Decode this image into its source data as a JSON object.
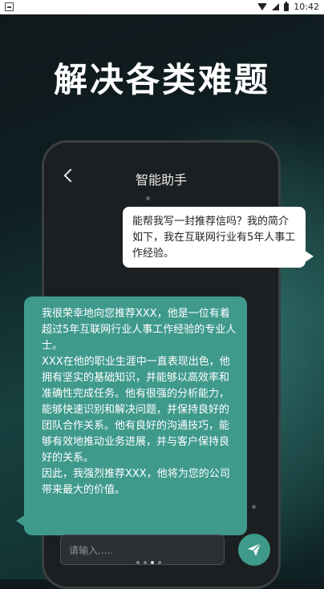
{
  "status_bar": {
    "time": "10:42",
    "icons": [
      "app-notification-icon",
      "wifi-icon",
      "signal-icon",
      "battery-icon"
    ]
  },
  "headline": "解决各类难题",
  "phone": {
    "title": "智能助手",
    "back_icon": "chevron-left-icon"
  },
  "chat": {
    "user_message": "能帮我写一封推荐信吗？我的简介如下，我在互联网行业有5年人事工作经验。",
    "assistant_paragraphs": [
      "我很荣幸地向您推荐XXX，他是一位有着超过5年互联网行业人事工作经验的专业人士。",
      "XXX在他的职业生涯中一直表现出色，他拥有坚实的基础知识，并能够以高效率和准确性完成任务。他有很强的分析能力，能够快速识别和解决问题，并保持良好的团队合作关系。他有良好的沟通技巧，能够有效地推动业务进展，并与客户保持良好的关系。",
      "因此，我强烈推荐XXX，他将为您的公司带来最大的价值。"
    ]
  },
  "input": {
    "placeholder": "请输入....."
  },
  "send_button": {
    "icon": "paper-plane-icon"
  },
  "colors": {
    "accent": "#3f9a8c",
    "background_dark": "#0f1e22",
    "phone_body": "#1c1f21"
  },
  "pager": {
    "count": 4,
    "active_index": 2
  }
}
